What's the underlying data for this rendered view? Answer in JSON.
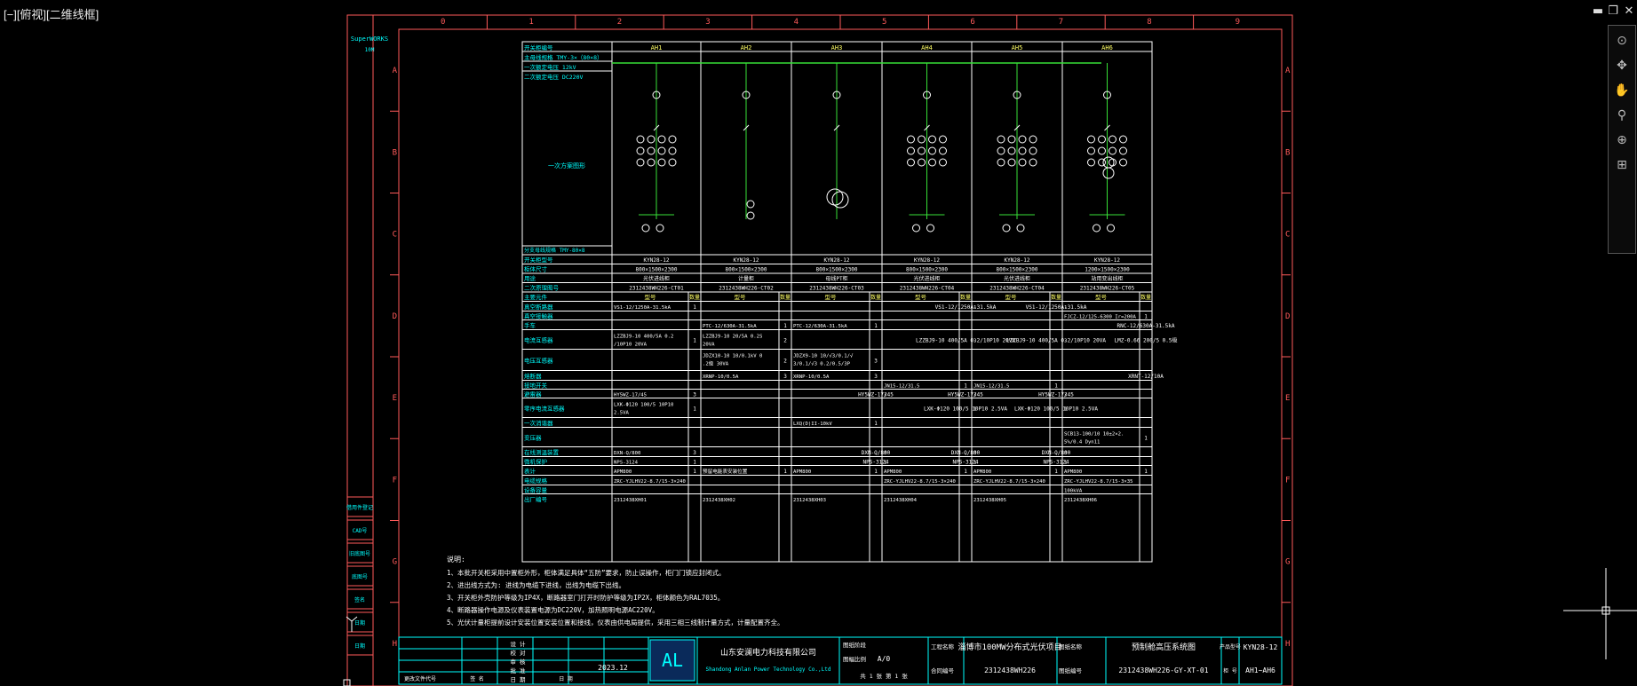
{
  "viewport": {
    "label": "[−][俯视][二维线框]"
  },
  "window_controls": {
    "min": "▬",
    "restore": "❐",
    "close": "✕"
  },
  "nav_icons": [
    "⊙",
    "✥",
    "✋",
    "⚲",
    "⊕",
    "⊞"
  ],
  "logo": {
    "brand": "SuperWORKS",
    "sub": "10M"
  },
  "border": {
    "cols": [
      "0",
      "1",
      "2",
      "3",
      "4",
      "5",
      "6",
      "7",
      "8",
      "9"
    ],
    "rows": [
      "A",
      "B",
      "C",
      "D",
      "E",
      "F",
      "G",
      "H"
    ]
  },
  "left_strip": [
    "借用件登记",
    "CAD号",
    "旧底图号",
    "底图号",
    "签名",
    "日期",
    "日期"
  ],
  "table": {
    "bus_header": [
      [
        "开关柜编号",
        ""
      ],
      [
        "主母线规格",
        "TMY-3×（80×8）"
      ],
      [
        "一次额定电压",
        "12kV"
      ],
      [
        "二次额定电压",
        "DC220V"
      ]
    ],
    "scheme_label": "一次方案图形",
    "branch_label": "分支母线规格 TMY-80×8",
    "cabinets": [
      "AH1",
      "AH2",
      "AH3",
      "AH4",
      "AH5",
      "AH6"
    ],
    "row_labels": [
      "开关柜型号",
      "柜体尺寸",
      "用途",
      "二次原理图号"
    ],
    "models": [
      "KYN28-12",
      "KYN28-12",
      "KYN28-12",
      "KYN28-12",
      "KYN28-12",
      "KYN28-12"
    ],
    "sizes": [
      "800×1500×2300",
      "800×1500×2300",
      "800×1500×2300",
      "800×1500×2300",
      "800×1500×2300",
      "1200×1500×2300"
    ],
    "uses": [
      "光伏进线柜",
      "计量柜",
      "母线PT柜",
      "光伏进线柜",
      "光伏进线柜",
      "站用变出线柜"
    ],
    "drawings": [
      "2312438WH226-CT01",
      "2312438WH226-CT02",
      "2312438WH226-CT03",
      "2312438WH226-CT04",
      "2312438WH226-CT04",
      "2312438WH226-CT05"
    ],
    "main_elements_label": "主要元件",
    "col_model": "型号",
    "col_qty": "数量",
    "items": [
      [
        "真空断路器",
        "VS1-12/1250A-31.5kA|1||||||VS1-12/1250A-31.5kA|1|VS1-12/1250A-31.5kA|1||"
      ],
      [
        "真空接触器",
        "||||||||||FJCZ-12/125-6300 Ir=200A|1"
      ],
      [
        "手车",
        "||PTC-12/630A-31.5kA|1|PTC-12/630A-31.5kA|1||||||RNC-12/630A-31.5kA|1"
      ],
      [
        "电流互感器",
        "LZZBJ9-10 400/5A 0.2/10P10 20VA|1|LZZBJ9-10 20/5A 0.2S 20VA|2||||LZZBJ9-10 400/5A 0.2/10P10 20VA|3|LZZBJ9-10 400/5A 0.2/10P10 20VA|3|LMZ-0.66 200/5 0.5级|3"
      ],
      [
        "电压互感器",
        "||JDZX10-10 10/0.1kV 0.2级 30VA|2|JDZX9-10 10/√3/0.1/√3/0.1/√3 0.2/0.5/3P|3||||||"
      ],
      [
        "熔断器",
        "||XRNP-10/0.5A|3|XRNP-10/0.5A|3||||||XRNT-12/10A|3"
      ],
      [
        "接地开关",
        "||||||JN15-12/31.5|1|JN15-12/31.5|1||"
      ],
      [
        "避雷器",
        "HY5WZ-17/45|3||||HY5WZ-17/45|3|HY5WZ-17/45|3|HY5WZ-17/45|3||"
      ],
      [
        "零序电流互感器",
        "LXK-Φ120 100/5 10P10 2.5VA|1||||||LXK-Φ120 100/5 10P10 2.5VA|1|LXK-Φ120 100/5 10P10 2.5VA|1||"
      ],
      [
        "一次消谐器",
        "||||LXQ(D)II-10kV|1||||||"
      ],
      [
        "变压器",
        "||||||||||SCB13-100/10 10±2×2.5%/0.4 Dyn11|1"
      ],
      [
        "在线测温装置",
        "DXN-Q/800|3||||DXN-Q/800|3|DXN-Q/800|3|DXN-Q/800|3||"
      ],
      [
        "微机保护",
        "NPS-3124|1||||NPS-3124|1|NPS-3124|1|NPS-3124|1||"
      ],
      [
        "表计",
        "APM800|1|预留电能表安装位置|1|APM800|1|APM800|1|APM800|1|APM800|1"
      ],
      [
        "电缆规格",
        "ZRC-YJLHV22-8.7/15-3×240||||||ZRC-YJLHV22-8.7/15-3×240||ZRC-YJLHV22-8.7/15-3×240||ZRC-YJLHV22-8.7/15-3×35|"
      ],
      [
        "设备容量",
        "||||||||||100kVA|"
      ],
      [
        "出厂编号",
        "2312438XH01||2312438XH02||2312438XH03||2312438XH04||2312438XH05||2312438XH06|"
      ]
    ]
  },
  "notes": {
    "title": "说明:",
    "lines": [
      "1、本批开关柜采用中置柜外形，柜体满足具体“五防”要求，防止误操作，柜门门锁应封闭式。",
      "2、进出线方式为: 进线为电缆下进线，出线为电缆下出线。",
      "3、开关柜外壳防护等级为IP4X，断路器室门打开时防护等级为IP2X，柜体颜色为RAL7035。",
      "4、断路器操作电源及仪表装置电源为DC220V，加热照明电源AC220V。",
      "5、光伏计量柜提前设计安装位置安装位置和接线，仪表由供电局提供，采用三相三线制计量方式，计量配置齐全。"
    ]
  },
  "titleblock": {
    "company_cn": "山东安澜电力科技有限公司",
    "company_en": "Shandong Anlan Power Technology Co.,Ltd",
    "project_label": "工程名称",
    "project": "淄博市100MW分布式光伏项目",
    "contract_label": "合同编号",
    "contract": "2312438WH226",
    "drawing_name_label": "图纸名称",
    "drawing_name": "预制舱高压系统图",
    "drawing_no_label": "图纸编号",
    "drawing_no": "2312438WH226-GY-XT-01",
    "product_label": "产品型号",
    "product": "KYN28-12",
    "cabinet_no_label": "柜 号",
    "cabinet_no": "AH1~AH6",
    "design_stage_label": "图纸阶段",
    "scale_label": "图幅比例",
    "scale": "A/0",
    "sheet_label": "共 1 张 第 1 张",
    "date": "2023.12",
    "roles": [
      "设 计",
      "校 对",
      "审 核",
      "批 准",
      "日 期"
    ],
    "change_label": "更改文件代号",
    "sign_labels": [
      "签 名",
      "日 期"
    ]
  }
}
